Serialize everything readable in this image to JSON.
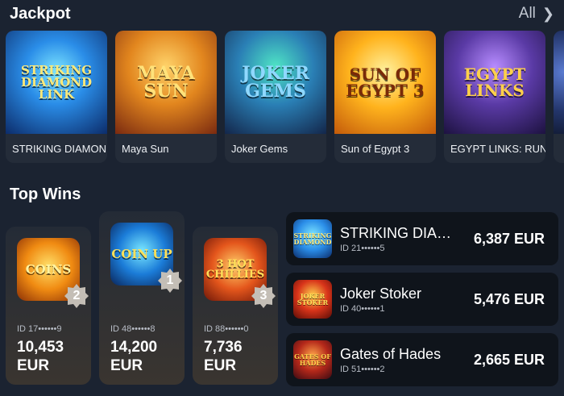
{
  "jackpot": {
    "title": "Jackpot",
    "all_label": "All",
    "games": [
      {
        "name": "STRIKING DIAMOND LINK",
        "logo": "STRIKING DIAMOND LINK"
      },
      {
        "name": "Maya Sun",
        "logo": "MAYA SUN"
      },
      {
        "name": "Joker Gems",
        "logo": "JOKER GEMS"
      },
      {
        "name": "Sun of Egypt 3",
        "logo": "SUN OF EGYPT 3"
      },
      {
        "name": "EGYPT LINKS: RUNNING WINS",
        "logo": "EGYPT LINKS"
      }
    ]
  },
  "top_wins": {
    "title": "Top Wins",
    "podium": [
      {
        "rank": "2",
        "id": "ID 17••••••9",
        "amount": "10,453",
        "currency": "EUR",
        "logo": "COINS"
      },
      {
        "rank": "1",
        "id": "ID 48••••••8",
        "amount": "14,200",
        "currency": "EUR",
        "logo": "COIN UP"
      },
      {
        "rank": "3",
        "id": "ID 88••••••0",
        "amount": "7,736",
        "currency": "EUR",
        "logo": "3 HOT CHILLIES"
      }
    ],
    "list": [
      {
        "name": "STRIKING DIAMOND LINK",
        "id": "ID 21••••••5",
        "amount": "6,387 EUR",
        "logo": "STRIKING DIAMOND"
      },
      {
        "name": "Joker Stoker",
        "id": "ID 40••••••1",
        "amount": "5,476 EUR",
        "logo": "JOKER STOKER"
      },
      {
        "name": "Gates of Hades",
        "id": "ID 51••••••2",
        "amount": "2,665 EUR",
        "logo": "GATES OF HADES"
      }
    ]
  },
  "colors": {
    "background": "#1b2331",
    "card": "#242c39",
    "row": "#0f141b",
    "badge": "#c4beb6"
  }
}
